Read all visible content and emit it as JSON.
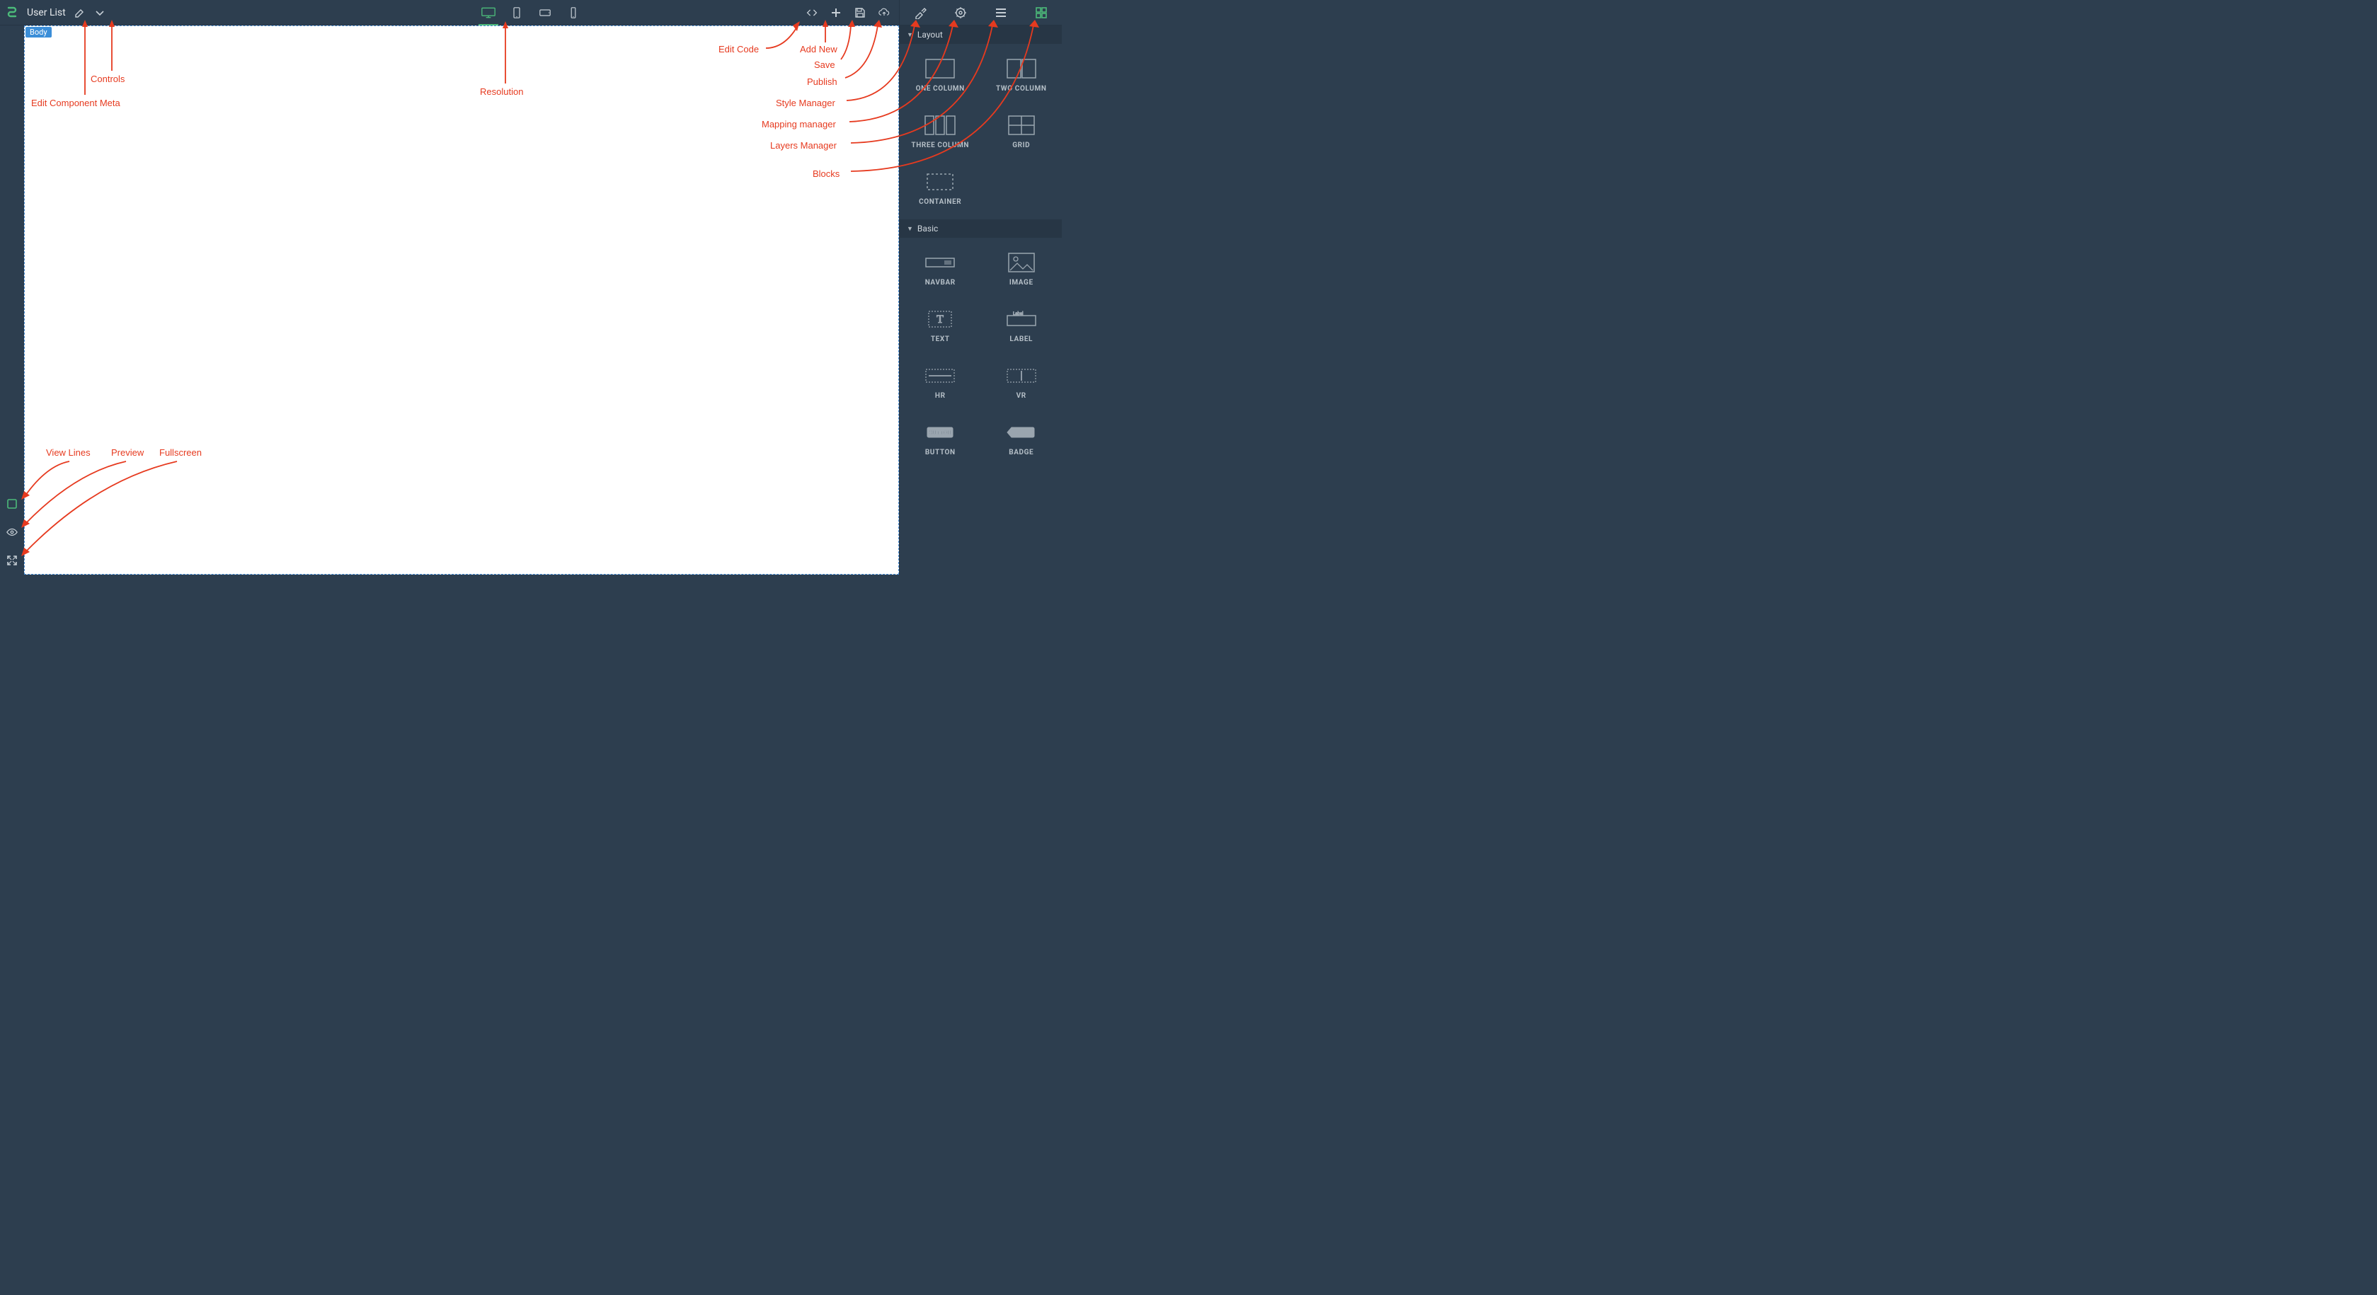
{
  "header": {
    "page_title": "User List"
  },
  "canvas": {
    "selection_label": "Body"
  },
  "right_panel": {
    "sections": {
      "layout": {
        "title": "Layout",
        "items": [
          "ONE COLUMN",
          "TWO COLUMN",
          "THREE COLUMN",
          "GRID",
          "CONTAINER"
        ]
      },
      "basic": {
        "title": "Basic",
        "items": [
          "NAVBAR",
          "IMAGE",
          "TEXT",
          "LABEL",
          "HR",
          "VR",
          "BUTTON",
          "BADGE"
        ]
      }
    }
  },
  "icons": {
    "edit": "pencil-icon",
    "controls": "chevron-down-icon",
    "desktop": "desktop-icon",
    "tablet": "tablet-icon",
    "tablet_landscape": "tablet-landscape-icon",
    "mobile": "mobile-icon",
    "code": "code-icon",
    "add": "plus-icon",
    "save": "save-icon",
    "publish": "cloud-upload-icon",
    "style": "paintbrush-icon",
    "settings": "gear-icon",
    "layers": "hamburger-icon",
    "blocks": "grid-icon",
    "view_lines": "square-outline-icon",
    "preview": "eye-icon",
    "fullscreen": "expand-icon"
  },
  "block_inline_text": {
    "button_tag": "BUTTON",
    "badge_tag": "Badge",
    "label_tag": "Label"
  },
  "annotations": {
    "edit_component_meta": "Edit Component Meta",
    "controls": "Controls",
    "resolution": "Resolution",
    "edit_code": "Edit Code",
    "add_new": "Add New",
    "save": "Save",
    "publish": "Publish",
    "style_manager": "Style Manager",
    "mapping_manager": "Mapping manager",
    "layers_manager": "Layers Manager",
    "blocks": "Blocks",
    "view_lines": "View Lines",
    "preview": "Preview",
    "fullscreen": "Fullscreen"
  },
  "colors": {
    "accent": "#4cbb7a",
    "bg": "#2d3e4f",
    "annotation": "#e63a1f",
    "selection": "#3b8ed8"
  }
}
